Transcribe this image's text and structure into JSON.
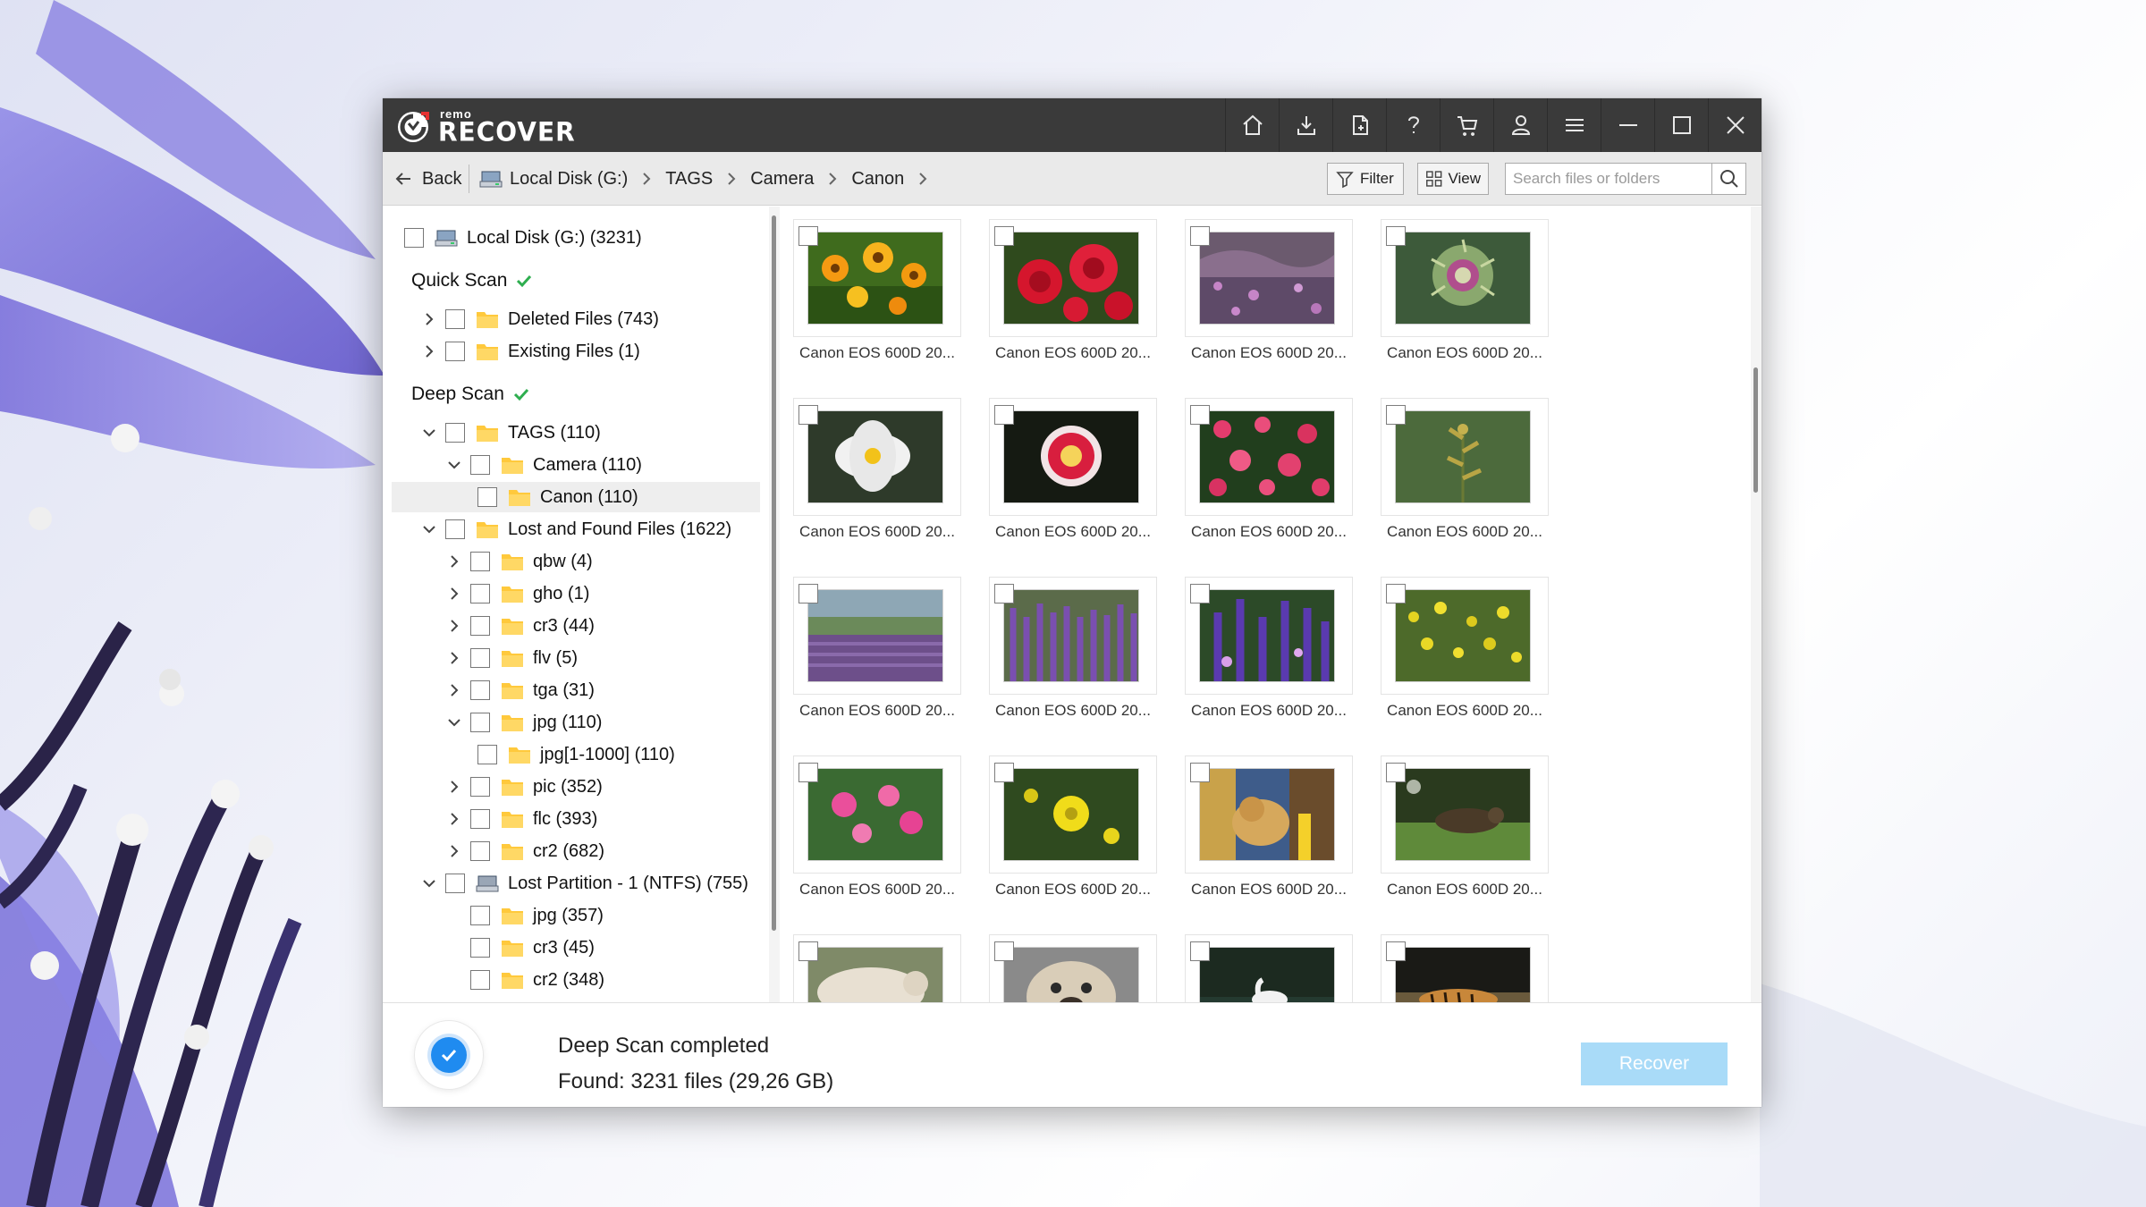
{
  "app": {
    "brand_small": "remo",
    "brand_big": "RECOVER",
    "title_actions": [
      "home-icon",
      "download-icon",
      "save-report-icon",
      "help-icon",
      "cart-icon",
      "account-icon",
      "menu-icon",
      "minimize-icon",
      "maximize-icon",
      "close-icon"
    ]
  },
  "nav": {
    "back_label": "Back",
    "breadcrumb": [
      "Local Disk (G:)",
      "TAGS",
      "Camera",
      "Canon"
    ],
    "filter_label": "Filter",
    "view_label": "View",
    "search_placeholder": "Search files or folders"
  },
  "tree": {
    "root_label": "Local Disk (G:) (3231)",
    "quick_scan": {
      "label": "Quick Scan",
      "items": [
        {
          "label": "Deleted Files (743)"
        },
        {
          "label": "Existing Files (1)"
        }
      ]
    },
    "deep_scan": {
      "label": "Deep Scan",
      "tags": {
        "label": "TAGS (110)",
        "camera": "Camera (110)",
        "canon": "Canon (110)"
      },
      "lost_found": {
        "label": "Lost and Found Files (1622)",
        "items": [
          "qbw (4)",
          "gho (1)",
          "cr3 (44)",
          "flv (5)",
          "tga (31)",
          "jpg (110)",
          "jpg[1-1000] (110)",
          "pic (352)",
          "flc (393)",
          "cr2 (682)"
        ]
      },
      "lost_partition": {
        "label": "Lost Partition - 1 (NTFS) (755)",
        "items": [
          "jpg (357)",
          "cr3 (45)",
          "cr2 (348)"
        ]
      }
    }
  },
  "grid": {
    "captions": [
      "Canon EOS 600D 20...",
      "Canon EOS 600D 20...",
      "Canon EOS 600D 20...",
      "Canon EOS 600D 20...",
      "Canon EOS 600D 20...",
      "Canon EOS 600D 20...",
      "Canon EOS 600D 20...",
      "Canon EOS 600D 20...",
      "Canon EOS 600D 20...",
      "Canon EOS 600D 20...",
      "Canon EOS 600D 20...",
      "Canon EOS 600D 20...",
      "Canon EOS 600D 20...",
      "Canon EOS 600D 20...",
      "Canon EOS 600D 20...",
      "Canon EOS 600D 20..."
    ]
  },
  "footer": {
    "status_title": "Deep Scan completed",
    "status_found": "Found: 3231 files (29,26 GB)",
    "recover_label": "Recover"
  },
  "colors": {
    "titlebar": "#3a3a3a",
    "accent_blue": "#1f8bf0",
    "recover_disabled": "#a9dbf8",
    "scan_check": "#2eae4f",
    "folder": "#ffc93c"
  }
}
